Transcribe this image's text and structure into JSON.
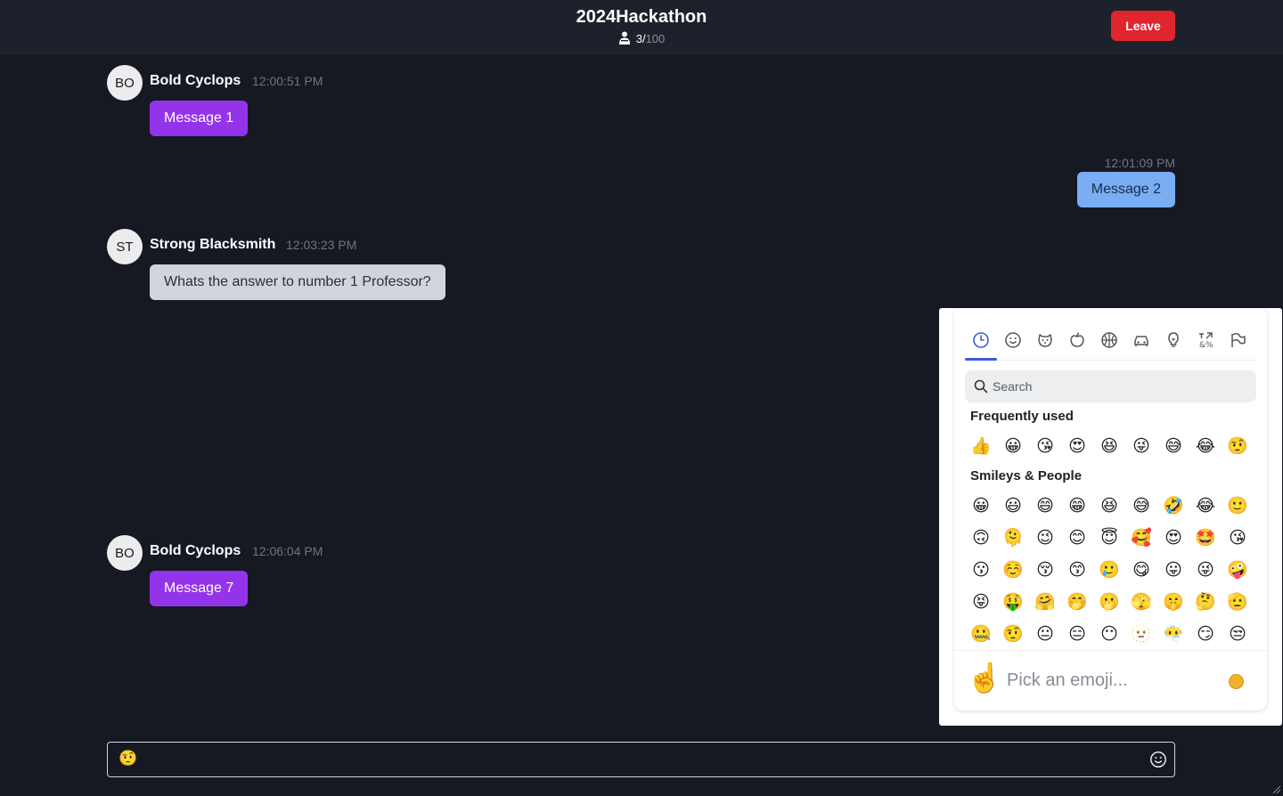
{
  "header": {
    "room_title": "2024Hackathon",
    "member_count": "3",
    "member_max": "100",
    "leave_label": "Leave"
  },
  "messages": [
    {
      "avatar": "BO",
      "author": "Bold Cyclops",
      "time": "12:00:51 PM",
      "text": "Message 1",
      "own": false
    },
    {
      "time": "12:01:09 PM",
      "text": "Message 2",
      "own": true
    },
    {
      "avatar": "ST",
      "author": "Strong Blacksmith",
      "time": "12:03:23 PM",
      "text": "Whats the answer to number 1 Professor?",
      "own": false
    },
    {
      "avatar": "BO",
      "author": "Bold Cyclops",
      "time": "12:06:04 PM",
      "text": "Message 7",
      "own": false
    }
  ],
  "composer": {
    "value": "🤨"
  },
  "emoji_picker": {
    "categories": [
      "frequently-used-icon",
      "smileys-icon",
      "animals-icon",
      "food-icon",
      "activities-icon",
      "travel-icon",
      "objects-icon",
      "symbols-icon",
      "flags-icon"
    ],
    "active_category": "frequently-used-icon",
    "search_placeholder": "Search",
    "frequently_used_title": "Frequently used",
    "frequently_used": [
      "👍",
      "😀",
      "😘",
      "😍",
      "😆",
      "😜",
      "😅",
      "😂",
      "🤨"
    ],
    "smileys_title": "Smileys & People",
    "smileys": [
      [
        "😀",
        "😃",
        "😄",
        "😁",
        "😆",
        "😅",
        "🤣",
        "😂",
        "🙂"
      ],
      [
        "🙃",
        "🫠",
        "😉",
        "😊",
        "😇",
        "🥰",
        "😍",
        "🤩",
        "😘"
      ],
      [
        "😗",
        "☺️",
        "😚",
        "😙",
        "🥲",
        "😋",
        "😛",
        "😜",
        "🤪"
      ],
      [
        "😝",
        "🤑",
        "🤗",
        "🤭",
        "🫢",
        "🫣",
        "🤫",
        "🤔",
        "🫡"
      ],
      [
        "🤐",
        "🤨",
        "😐",
        "😑",
        "😶",
        "🫥",
        "😶‍🌫️",
        "😏",
        "😒"
      ]
    ],
    "preview_emoji": "☝️",
    "preview_text": "Pick an emoji...",
    "skin_tone_color": "#f3b12a"
  }
}
